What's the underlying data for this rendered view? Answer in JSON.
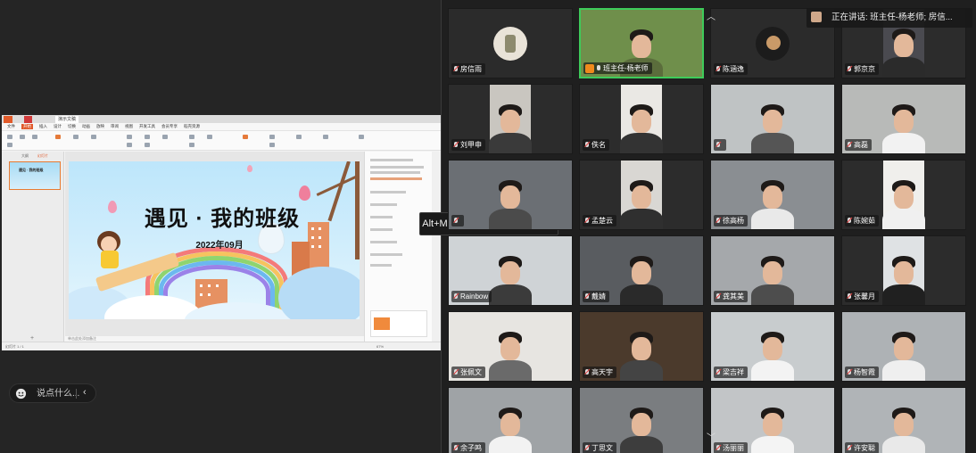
{
  "shared_window": {
    "tabs": [
      "演示文稿"
    ],
    "menus": [
      "文件",
      "开始",
      "插入",
      "设计",
      "切换",
      "动画",
      "放映",
      "审阅",
      "视图",
      "开发工具",
      "会员专享",
      "稻壳资源"
    ],
    "slide_panel_tabs": [
      "大纲",
      "幻灯片"
    ],
    "thumb_title": "遇见 · 我的班级",
    "notes_placeholder": "单击此处添加备注",
    "status_left": "幻灯片 1 / 1",
    "status_zoom": "67%"
  },
  "slide": {
    "title": "遇见 · 我的班级",
    "date": "2022年09月"
  },
  "comment_bar": {
    "placeholder": "说点什么...",
    "collapse": "‹"
  },
  "mic_tooltip": "Alt+M或按住空格键开启麦克风",
  "speaking": {
    "text": "正在讲话: 班主任-杨老师; 房信..."
  },
  "participants": [
    {
      "name": "房信雨",
      "mic": "off",
      "kind": "avatar"
    },
    {
      "name": "班主任-杨老师",
      "mic": "on",
      "kind": "video",
      "host": true,
      "speaking": true
    },
    {
      "name": "陈涵逸",
      "mic": "off",
      "kind": "avatar2"
    },
    {
      "name": "郭京京",
      "mic": "off",
      "kind": "video"
    },
    {
      "name": "刘甲申",
      "mic": "off",
      "kind": "video"
    },
    {
      "name": "佚名",
      "mic": "off",
      "kind": "video"
    },
    {
      "name": "",
      "mic": "off",
      "kind": "video"
    },
    {
      "name": "高磊",
      "mic": "off",
      "kind": "video"
    },
    {
      "name": "",
      "mic": "off",
      "kind": "video"
    },
    {
      "name": "孟楚云",
      "mic": "off",
      "kind": "video"
    },
    {
      "name": "徐高杨",
      "mic": "off",
      "kind": "video"
    },
    {
      "name": "陈婉茹",
      "mic": "off",
      "kind": "video"
    },
    {
      "name": "Rainbow",
      "mic": "off",
      "kind": "video"
    },
    {
      "name": "戴婧",
      "mic": "off",
      "kind": "video"
    },
    {
      "name": "龚其美",
      "mic": "off",
      "kind": "video"
    },
    {
      "name": "张馨月",
      "mic": "off",
      "kind": "video"
    },
    {
      "name": "张佩文",
      "mic": "off",
      "kind": "video"
    },
    {
      "name": "高天宇",
      "mic": "off",
      "kind": "video"
    },
    {
      "name": "梁吉祥",
      "mic": "off",
      "kind": "video"
    },
    {
      "name": "杨智霞",
      "mic": "off",
      "kind": "video"
    },
    {
      "name": "余子鸣",
      "mic": "off",
      "kind": "video"
    },
    {
      "name": "丁思文",
      "mic": "off",
      "kind": "video"
    },
    {
      "name": "汤丽丽",
      "mic": "off",
      "kind": "video"
    },
    {
      "name": "许安聪",
      "mic": "off",
      "kind": "video"
    }
  ],
  "icons": {
    "scroll_up": "chevron-up-icon",
    "scroll_down": "chevron-down-icon",
    "emoji": "smiley-icon"
  }
}
